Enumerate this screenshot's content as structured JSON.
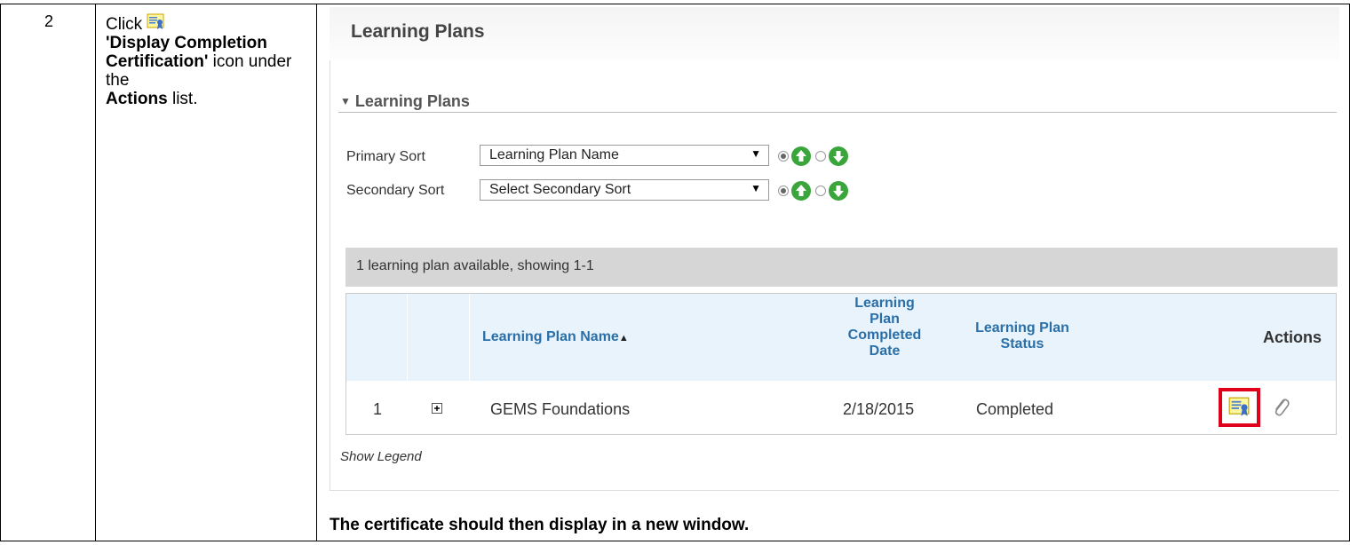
{
  "step": {
    "number": "2",
    "instruction": {
      "click": "Click",
      "icon_name": "display-completion-certification-icon",
      "quoted_label": "'Display Completion Certification'",
      "mid": "icon under the",
      "actions_word": "Actions",
      "end": "list."
    }
  },
  "screenshot": {
    "page_title": "Learning Plans",
    "section_title": "Learning Plans",
    "primary_sort": {
      "label": "Primary Sort",
      "value": "Learning Plan Name",
      "ascending_selected": true
    },
    "secondary_sort": {
      "label": "Secondary Sort",
      "value": "Select Secondary Sort",
      "ascending_selected": true
    },
    "summary": "1 learning plan available, showing 1-1",
    "table": {
      "headers": {
        "name": "Learning Plan Name",
        "completed_date": "Learning Plan Completed Date",
        "status": "Learning Plan Status",
        "actions": "Actions"
      },
      "rows": [
        {
          "index": "1",
          "name": "GEMS Foundations",
          "completed_date": "2/18/2015",
          "status": "Completed"
        }
      ]
    },
    "show_legend": "Show Legend"
  },
  "caption": "The certificate should then display in a new window.",
  "colors": {
    "link_blue": "#2a6fa8",
    "highlight_red": "#e0001a",
    "arrow_green": "#3aa53a",
    "header_bg": "#e8f3fb"
  }
}
